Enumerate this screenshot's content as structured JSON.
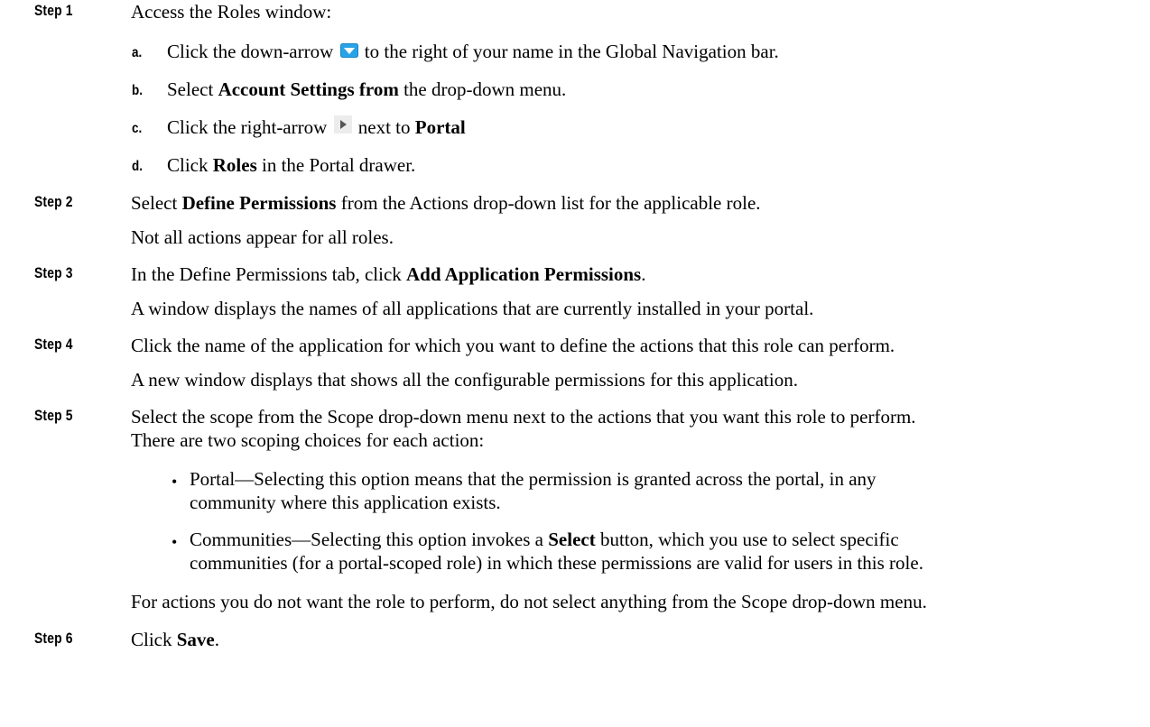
{
  "steps": [
    {
      "label": "Step 1",
      "text": "Access the Roles window:"
    },
    {
      "label": "Step 2",
      "pre": "Select ",
      "bold": "Define Permissions",
      "post": " from the Actions drop-down list for the applicable role.",
      "note": "Not all actions appear for all roles."
    },
    {
      "label": "Step 3",
      "pre": "In the Define Permissions tab, click ",
      "bold": "Add Application Permissions",
      "post": ".",
      "note": "A window displays the names of all applications that are currently installed in your portal."
    },
    {
      "label": "Step 4",
      "text": "Click the name of the application for which you want to define the actions that this role can perform.",
      "note": "A new window displays that shows all the configurable permissions for this application."
    },
    {
      "label": "Step 5",
      "text": "Select the scope from the Scope drop-down menu next to the actions that you want this role to perform.",
      "text2": "There are two scoping choices for each action:",
      "note": "For actions you do not want the role to perform, do not select anything from the Scope drop-down menu."
    },
    {
      "label": "Step 6",
      "pre": "Click ",
      "bold": "Save",
      "post": "."
    }
  ],
  "substeps": [
    {
      "letter": "a.",
      "pre": "Click the down-arrow ",
      "post": " to the right of your name in the Global Navigation bar.",
      "icon": "down-arrow-icon"
    },
    {
      "letter": "b.",
      "pre": "Select ",
      "bold": "Account Settings from",
      "post": " the drop-down menu."
    },
    {
      "letter": "c.",
      "pre": "Click the right-arrow ",
      "post": " next to ",
      "bold": "Portal",
      "icon": "right-arrow-icon"
    },
    {
      "letter": "d.",
      "pre": "Click ",
      "bold": "Roles",
      "post": " in the Portal drawer."
    }
  ],
  "bullets": [
    {
      "line1": "Portal—Selecting this option means that the permission is granted across the portal, in any",
      "line2": "community where this application exists."
    },
    {
      "line1_pre": "Communities—Selecting this option invokes a ",
      "line1_bold": "Select",
      "line1_post": " button, which you use to select specific",
      "line2": "communities (for a portal-scoped role) in which these permissions are valid for users in this role."
    }
  ],
  "bullet_char": "•",
  "colors": {
    "down_arrow_fill": "#2aa3e6",
    "right_arrow_fill": "#555555"
  }
}
